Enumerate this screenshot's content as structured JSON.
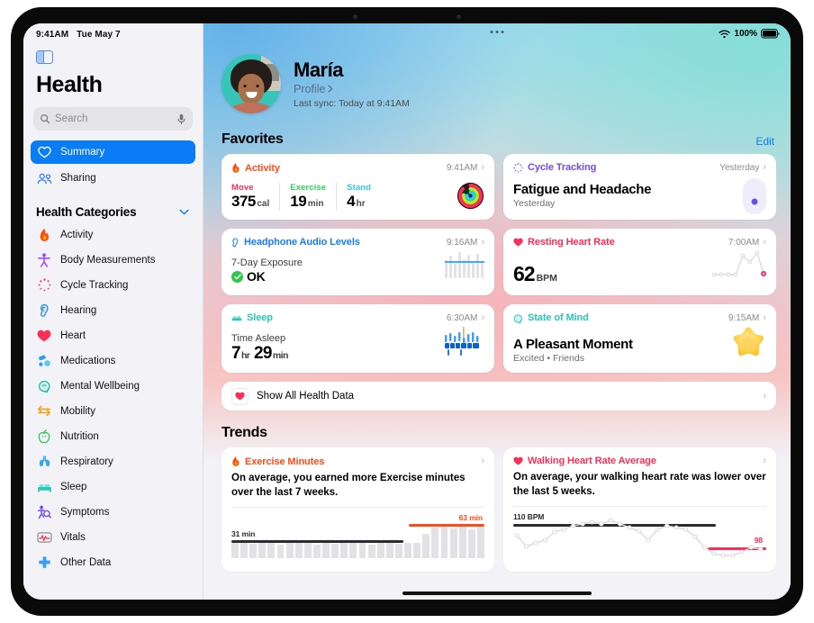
{
  "status_bar": {
    "time": "9:41AM",
    "date": "Tue May 7",
    "battery_percent": "100%",
    "wifi_icon": "wifi-icon",
    "battery_icon": "battery-icon"
  },
  "sidebar": {
    "toggle_icon": "sidebar-toggle-icon",
    "app_title": "Health",
    "search": {
      "placeholder": "Search",
      "value": "",
      "search_icon": "search-icon",
      "mic_icon": "microphone-icon"
    },
    "nav_top": [
      {
        "label": "Summary",
        "icon": "heart-outline-icon",
        "selected": true
      },
      {
        "label": "Sharing",
        "icon": "people-icon",
        "selected": false
      }
    ],
    "categories_header": {
      "label": "Health Categories",
      "chevron_icon": "chevron-down-icon"
    },
    "categories": [
      {
        "label": "Activity",
        "icon": "flame-icon"
      },
      {
        "label": "Body Measurements",
        "icon": "body-figure-icon"
      },
      {
        "label": "Cycle Tracking",
        "icon": "cycle-tracking-icon"
      },
      {
        "label": "Hearing",
        "icon": "ear-icon"
      },
      {
        "label": "Heart",
        "icon": "heart-filled-icon"
      },
      {
        "label": "Medications",
        "icon": "pills-icon"
      },
      {
        "label": "Mental Wellbeing",
        "icon": "head-profile-icon"
      },
      {
        "label": "Mobility",
        "icon": "mobility-arrows-icon"
      },
      {
        "label": "Nutrition",
        "icon": "apple-icon"
      },
      {
        "label": "Respiratory",
        "icon": "lungs-icon"
      },
      {
        "label": "Sleep",
        "icon": "bed-icon"
      },
      {
        "label": "Symptoms",
        "icon": "symptoms-icon"
      },
      {
        "label": "Vitals",
        "icon": "waveform-box-icon"
      },
      {
        "label": "Other Data",
        "icon": "plus-cross-icon"
      }
    ]
  },
  "main": {
    "multitask_icon": "multitasking-dots-icon",
    "profile": {
      "name": "María",
      "link_label": "Profile",
      "link_chevron": "chevron-right-icon",
      "last_sync": "Last sync: Today at 9:41AM",
      "avatar_icon": "avatar"
    },
    "favorites": {
      "title": "Favorites",
      "edit_label": "Edit",
      "cards": [
        {
          "title": "Activity",
          "icon": "flame-icon",
          "accent": "#fc4c18",
          "time": "9:41AM",
          "stats": [
            {
              "label": "Move",
              "value": "375",
              "unit": "cal",
              "color": "#fa2e56"
            },
            {
              "label": "Exercise",
              "value": "19",
              "unit": "min",
              "color": "#30d158"
            },
            {
              "label": "Stand",
              "value": "4",
              "unit": "hr",
              "color": "#34c6eb"
            }
          ],
          "rings_icon": "activity-rings-icon"
        },
        {
          "title": "Cycle Tracking",
          "icon": "cycle-tracking-icon",
          "accent": "#6b4bf5",
          "time": "Yesterday",
          "headline": "Fatigue and Headache",
          "sub": "Yesterday",
          "visual_icon": "cycle-dot-pill-icon"
        },
        {
          "title": "Headphone Audio Levels",
          "icon": "ear-icon",
          "accent": "#1a7cf0",
          "time": "9:16AM",
          "label": "7-Day Exposure",
          "status": "OK",
          "status_icon": "check-circle-icon",
          "visual_icon": "audio-levels-chart-icon"
        },
        {
          "title": "Resting Heart Rate",
          "icon": "heart-filled-icon",
          "accent": "#fa2e56",
          "time": "7:00AM",
          "value": "62",
          "unit": "BPM",
          "visual_icon": "heart-rate-line-chart-icon"
        },
        {
          "title": "Sleep",
          "icon": "bed-icon",
          "accent": "#2ac7ba",
          "time": "6:30AM",
          "label": "Time Asleep",
          "value_hr": "7",
          "unit_hr": "hr",
          "value_min": "29",
          "unit_min": "min",
          "visual_icon": "sleep-bars-chart-icon"
        },
        {
          "title": "State of Mind",
          "icon": "head-profile-icon",
          "accent": "#2ac7ba",
          "time": "9:15AM",
          "headline": "A Pleasant Moment",
          "sub": "Excited • Friends",
          "visual_icon": "star-blob-icon"
        }
      ],
      "show_all": {
        "label": "Show All Health Data",
        "icon": "heart-filled-icon",
        "chevron": "chevron-right-icon"
      }
    },
    "trends": {
      "title": "Trends",
      "cards": [
        {
          "title": "Exercise Minutes",
          "icon": "flame-icon",
          "accent": "#fc4c18",
          "text": "On average, you earned more Exercise minutes over the last 7 weeks.",
          "chevron": "chevron-right-icon"
        },
        {
          "title": "Walking Heart Rate Average",
          "icon": "heart-filled-icon",
          "accent": "#fa2e56",
          "text": "On average, your walking heart rate was lower over the last 5 weeks.",
          "chevron": "chevron-right-icon"
        }
      ]
    }
  },
  "chart_data": [
    {
      "type": "bar",
      "title": "Exercise Minutes",
      "baseline_label": "31 min",
      "baseline_value": 31,
      "highlight_label": "63 min",
      "highlight_value": 63,
      "ylabel": "minutes",
      "xlabel": "",
      "baseline_color": "#2b2b30",
      "highlight_color": "#fc4c18",
      "bar_color": "#e1e1e6",
      "values": [
        30,
        31,
        29,
        32,
        30,
        28,
        31,
        33,
        30,
        27,
        31,
        29,
        32,
        30,
        31,
        28,
        30,
        32,
        29,
        31,
        30,
        48,
        62,
        63,
        61,
        64,
        60,
        63
      ]
    },
    {
      "type": "line",
      "title": "Walking Heart Rate Average",
      "baseline_label": "110 BPM",
      "baseline_value": 110,
      "highlight_label": "98",
      "highlight_value": 98,
      "ylabel": "BPM",
      "xlabel": "",
      "baseline_color": "#2b2b30",
      "highlight_color": "#fa2e56",
      "line_color": "#d8d8de",
      "values": [
        108,
        101,
        103,
        105,
        109,
        110,
        112,
        113,
        114,
        113,
        115,
        113,
        111,
        109,
        105,
        110,
        112,
        111,
        110,
        106,
        100,
        96,
        95,
        95,
        97,
        99,
        98
      ]
    }
  ]
}
